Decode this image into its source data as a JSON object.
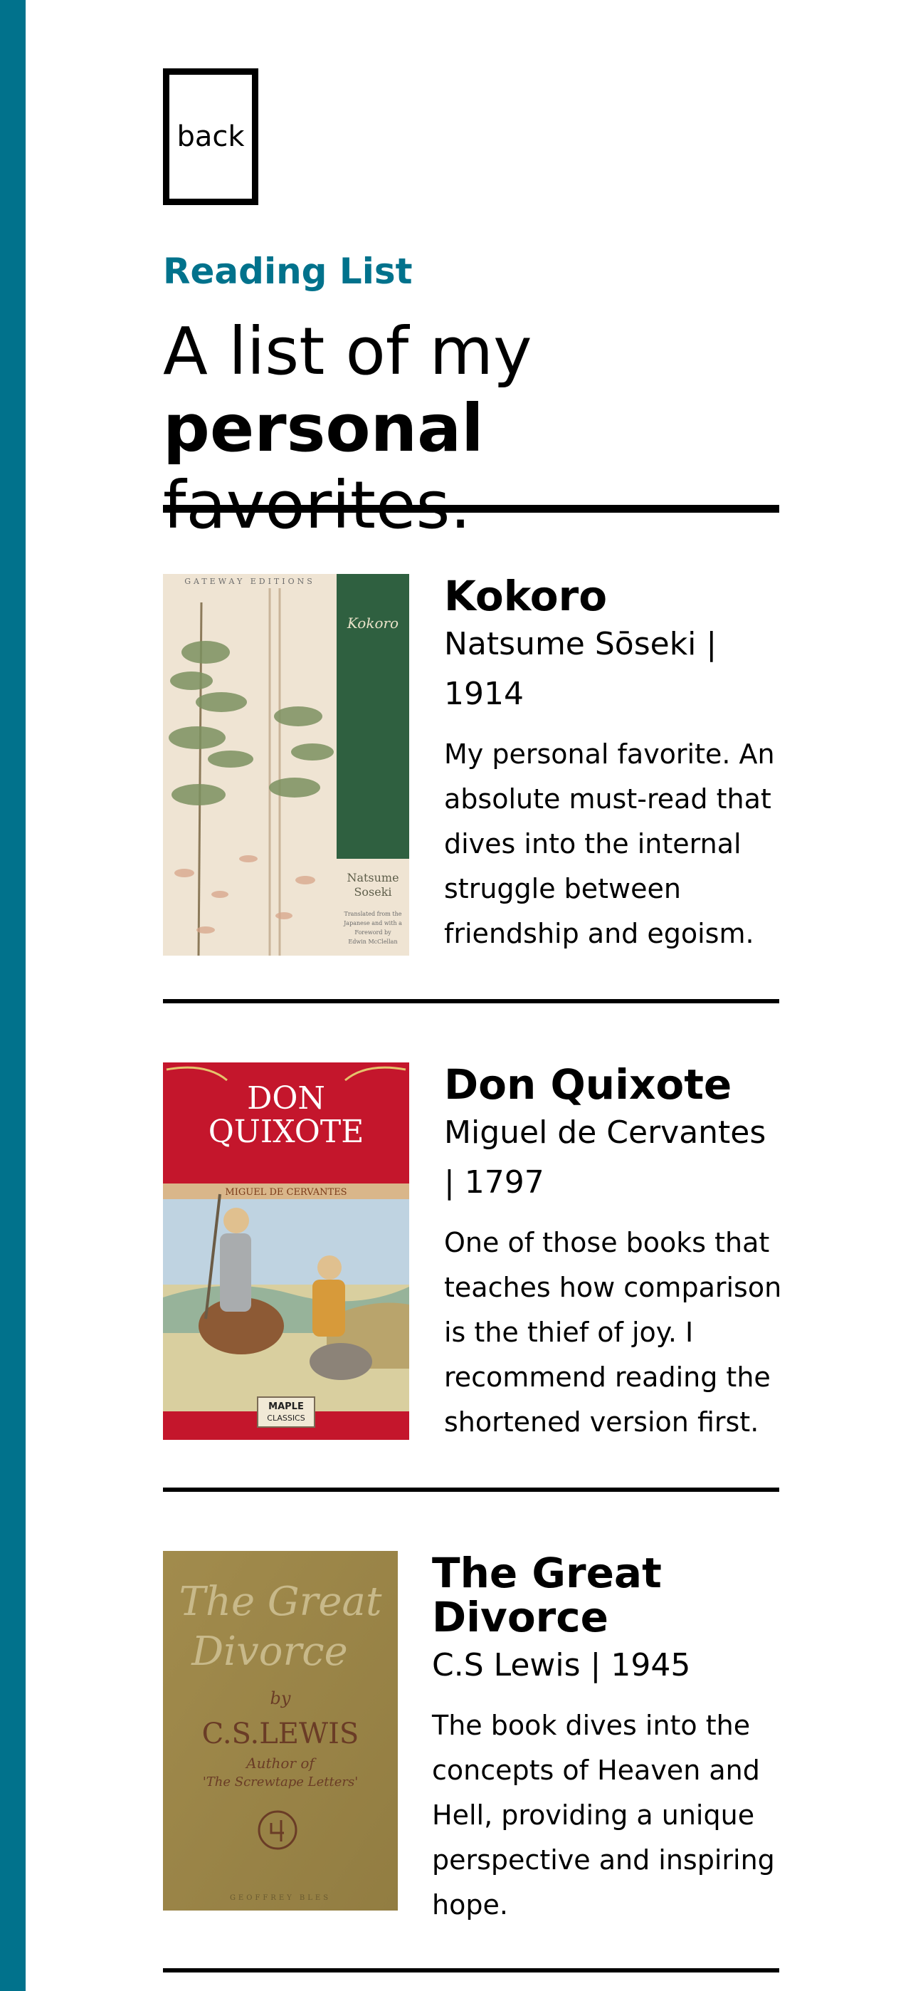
{
  "nav": {
    "back_label": "back"
  },
  "header": {
    "eyebrow": "Reading List",
    "headline_prefix": "A list of my ",
    "headline_bold": "personal",
    "headline_suffix": "favorites."
  },
  "colors": {
    "accent": "#01728c",
    "text": "#000000",
    "background": "#ffffff"
  },
  "books": [
    {
      "title": "Kokoro",
      "meta": "Natsume Sōseki | 1914",
      "description": "My personal favorite. An absolute must-read that dives into the internal struggle between friendship and egoism.",
      "cover": {
        "publisher": "GATEWAY EDITIONS",
        "title": "Kokoro",
        "author_line1": "Natsume",
        "author_line2": "Soseki",
        "note_line1": "Translated from the",
        "note_line2": "Japanese and with a",
        "note_line3": "Foreword by",
        "note_line4": "Edwin McClellan"
      }
    },
    {
      "title": "Don Quixote",
      "meta": "Miguel de Cervantes | 1797",
      "description": "One of those books that teaches how comparison is the thief of joy. I recommend reading the shortened version first.",
      "cover": {
        "title_line1": "DON",
        "title_line2": "QUIXOTE",
        "author": "MIGUEL DE CERVANTES",
        "badge_line1": "MAPLE",
        "badge_line2": "CLASSICS"
      }
    },
    {
      "title": "The Great Divorce",
      "meta": "C.S Lewis | 1945",
      "description": "The book dives into the concepts of Heaven and Hell, providing a unique perspective and inspiring hope.",
      "cover": {
        "title_line1": "The Great",
        "title_line2": "Divorce",
        "by": "by",
        "author": "C.S.LEWIS",
        "sub_line1": "Author of",
        "sub_line2": "'The Screwtape Letters'",
        "publisher": "GEOFFREY BLES"
      }
    }
  ]
}
